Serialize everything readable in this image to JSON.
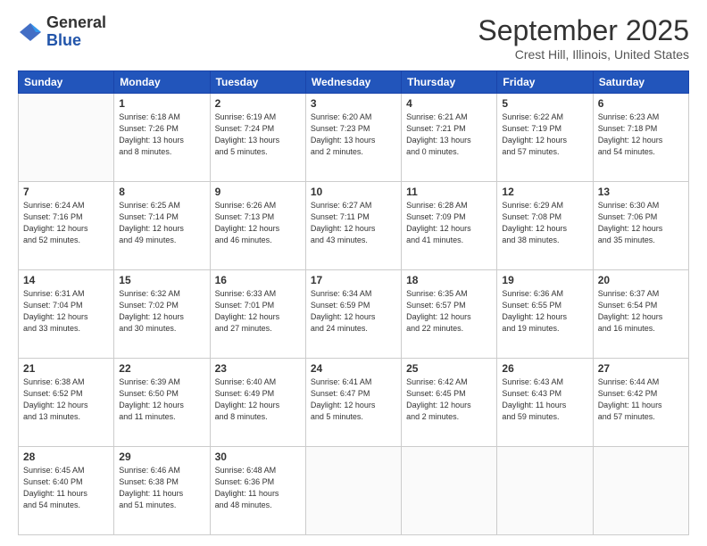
{
  "logo": {
    "general": "General",
    "blue": "Blue"
  },
  "header": {
    "month": "September 2025",
    "location": "Crest Hill, Illinois, United States"
  },
  "weekdays": [
    "Sunday",
    "Monday",
    "Tuesday",
    "Wednesday",
    "Thursday",
    "Friday",
    "Saturday"
  ],
  "weeks": [
    [
      {
        "day": "",
        "info": ""
      },
      {
        "day": "1",
        "info": "Sunrise: 6:18 AM\nSunset: 7:26 PM\nDaylight: 13 hours\nand 8 minutes."
      },
      {
        "day": "2",
        "info": "Sunrise: 6:19 AM\nSunset: 7:24 PM\nDaylight: 13 hours\nand 5 minutes."
      },
      {
        "day": "3",
        "info": "Sunrise: 6:20 AM\nSunset: 7:23 PM\nDaylight: 13 hours\nand 2 minutes."
      },
      {
        "day": "4",
        "info": "Sunrise: 6:21 AM\nSunset: 7:21 PM\nDaylight: 13 hours\nand 0 minutes."
      },
      {
        "day": "5",
        "info": "Sunrise: 6:22 AM\nSunset: 7:19 PM\nDaylight: 12 hours\nand 57 minutes."
      },
      {
        "day": "6",
        "info": "Sunrise: 6:23 AM\nSunset: 7:18 PM\nDaylight: 12 hours\nand 54 minutes."
      }
    ],
    [
      {
        "day": "7",
        "info": "Sunrise: 6:24 AM\nSunset: 7:16 PM\nDaylight: 12 hours\nand 52 minutes."
      },
      {
        "day": "8",
        "info": "Sunrise: 6:25 AM\nSunset: 7:14 PM\nDaylight: 12 hours\nand 49 minutes."
      },
      {
        "day": "9",
        "info": "Sunrise: 6:26 AM\nSunset: 7:13 PM\nDaylight: 12 hours\nand 46 minutes."
      },
      {
        "day": "10",
        "info": "Sunrise: 6:27 AM\nSunset: 7:11 PM\nDaylight: 12 hours\nand 43 minutes."
      },
      {
        "day": "11",
        "info": "Sunrise: 6:28 AM\nSunset: 7:09 PM\nDaylight: 12 hours\nand 41 minutes."
      },
      {
        "day": "12",
        "info": "Sunrise: 6:29 AM\nSunset: 7:08 PM\nDaylight: 12 hours\nand 38 minutes."
      },
      {
        "day": "13",
        "info": "Sunrise: 6:30 AM\nSunset: 7:06 PM\nDaylight: 12 hours\nand 35 minutes."
      }
    ],
    [
      {
        "day": "14",
        "info": "Sunrise: 6:31 AM\nSunset: 7:04 PM\nDaylight: 12 hours\nand 33 minutes."
      },
      {
        "day": "15",
        "info": "Sunrise: 6:32 AM\nSunset: 7:02 PM\nDaylight: 12 hours\nand 30 minutes."
      },
      {
        "day": "16",
        "info": "Sunrise: 6:33 AM\nSunset: 7:01 PM\nDaylight: 12 hours\nand 27 minutes."
      },
      {
        "day": "17",
        "info": "Sunrise: 6:34 AM\nSunset: 6:59 PM\nDaylight: 12 hours\nand 24 minutes."
      },
      {
        "day": "18",
        "info": "Sunrise: 6:35 AM\nSunset: 6:57 PM\nDaylight: 12 hours\nand 22 minutes."
      },
      {
        "day": "19",
        "info": "Sunrise: 6:36 AM\nSunset: 6:55 PM\nDaylight: 12 hours\nand 19 minutes."
      },
      {
        "day": "20",
        "info": "Sunrise: 6:37 AM\nSunset: 6:54 PM\nDaylight: 12 hours\nand 16 minutes."
      }
    ],
    [
      {
        "day": "21",
        "info": "Sunrise: 6:38 AM\nSunset: 6:52 PM\nDaylight: 12 hours\nand 13 minutes."
      },
      {
        "day": "22",
        "info": "Sunrise: 6:39 AM\nSunset: 6:50 PM\nDaylight: 12 hours\nand 11 minutes."
      },
      {
        "day": "23",
        "info": "Sunrise: 6:40 AM\nSunset: 6:49 PM\nDaylight: 12 hours\nand 8 minutes."
      },
      {
        "day": "24",
        "info": "Sunrise: 6:41 AM\nSunset: 6:47 PM\nDaylight: 12 hours\nand 5 minutes."
      },
      {
        "day": "25",
        "info": "Sunrise: 6:42 AM\nSunset: 6:45 PM\nDaylight: 12 hours\nand 2 minutes."
      },
      {
        "day": "26",
        "info": "Sunrise: 6:43 AM\nSunset: 6:43 PM\nDaylight: 11 hours\nand 59 minutes."
      },
      {
        "day": "27",
        "info": "Sunrise: 6:44 AM\nSunset: 6:42 PM\nDaylight: 11 hours\nand 57 minutes."
      }
    ],
    [
      {
        "day": "28",
        "info": "Sunrise: 6:45 AM\nSunset: 6:40 PM\nDaylight: 11 hours\nand 54 minutes."
      },
      {
        "day": "29",
        "info": "Sunrise: 6:46 AM\nSunset: 6:38 PM\nDaylight: 11 hours\nand 51 minutes."
      },
      {
        "day": "30",
        "info": "Sunrise: 6:48 AM\nSunset: 6:36 PM\nDaylight: 11 hours\nand 48 minutes."
      },
      {
        "day": "",
        "info": ""
      },
      {
        "day": "",
        "info": ""
      },
      {
        "day": "",
        "info": ""
      },
      {
        "day": "",
        "info": ""
      }
    ]
  ]
}
